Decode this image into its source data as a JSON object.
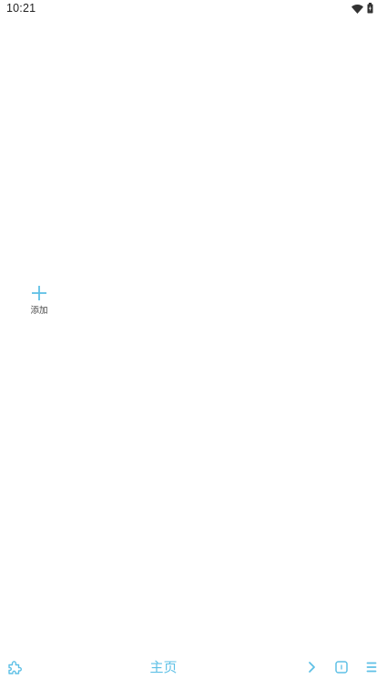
{
  "status_bar": {
    "time": "10:21",
    "icons": [
      "wifi-icon",
      "battery-icon"
    ]
  },
  "main": {
    "add_tile": {
      "icon": "plus-icon",
      "label": "添加"
    }
  },
  "bottom_bar": {
    "left_icon": "puzzle-icon",
    "title": "主页",
    "right_icons": [
      "chevron-right-icon",
      "tabs-icon",
      "menu-icon"
    ]
  },
  "colors": {
    "accent": "#5ec0e6",
    "text": "#333333",
    "background": "#ffffff"
  }
}
